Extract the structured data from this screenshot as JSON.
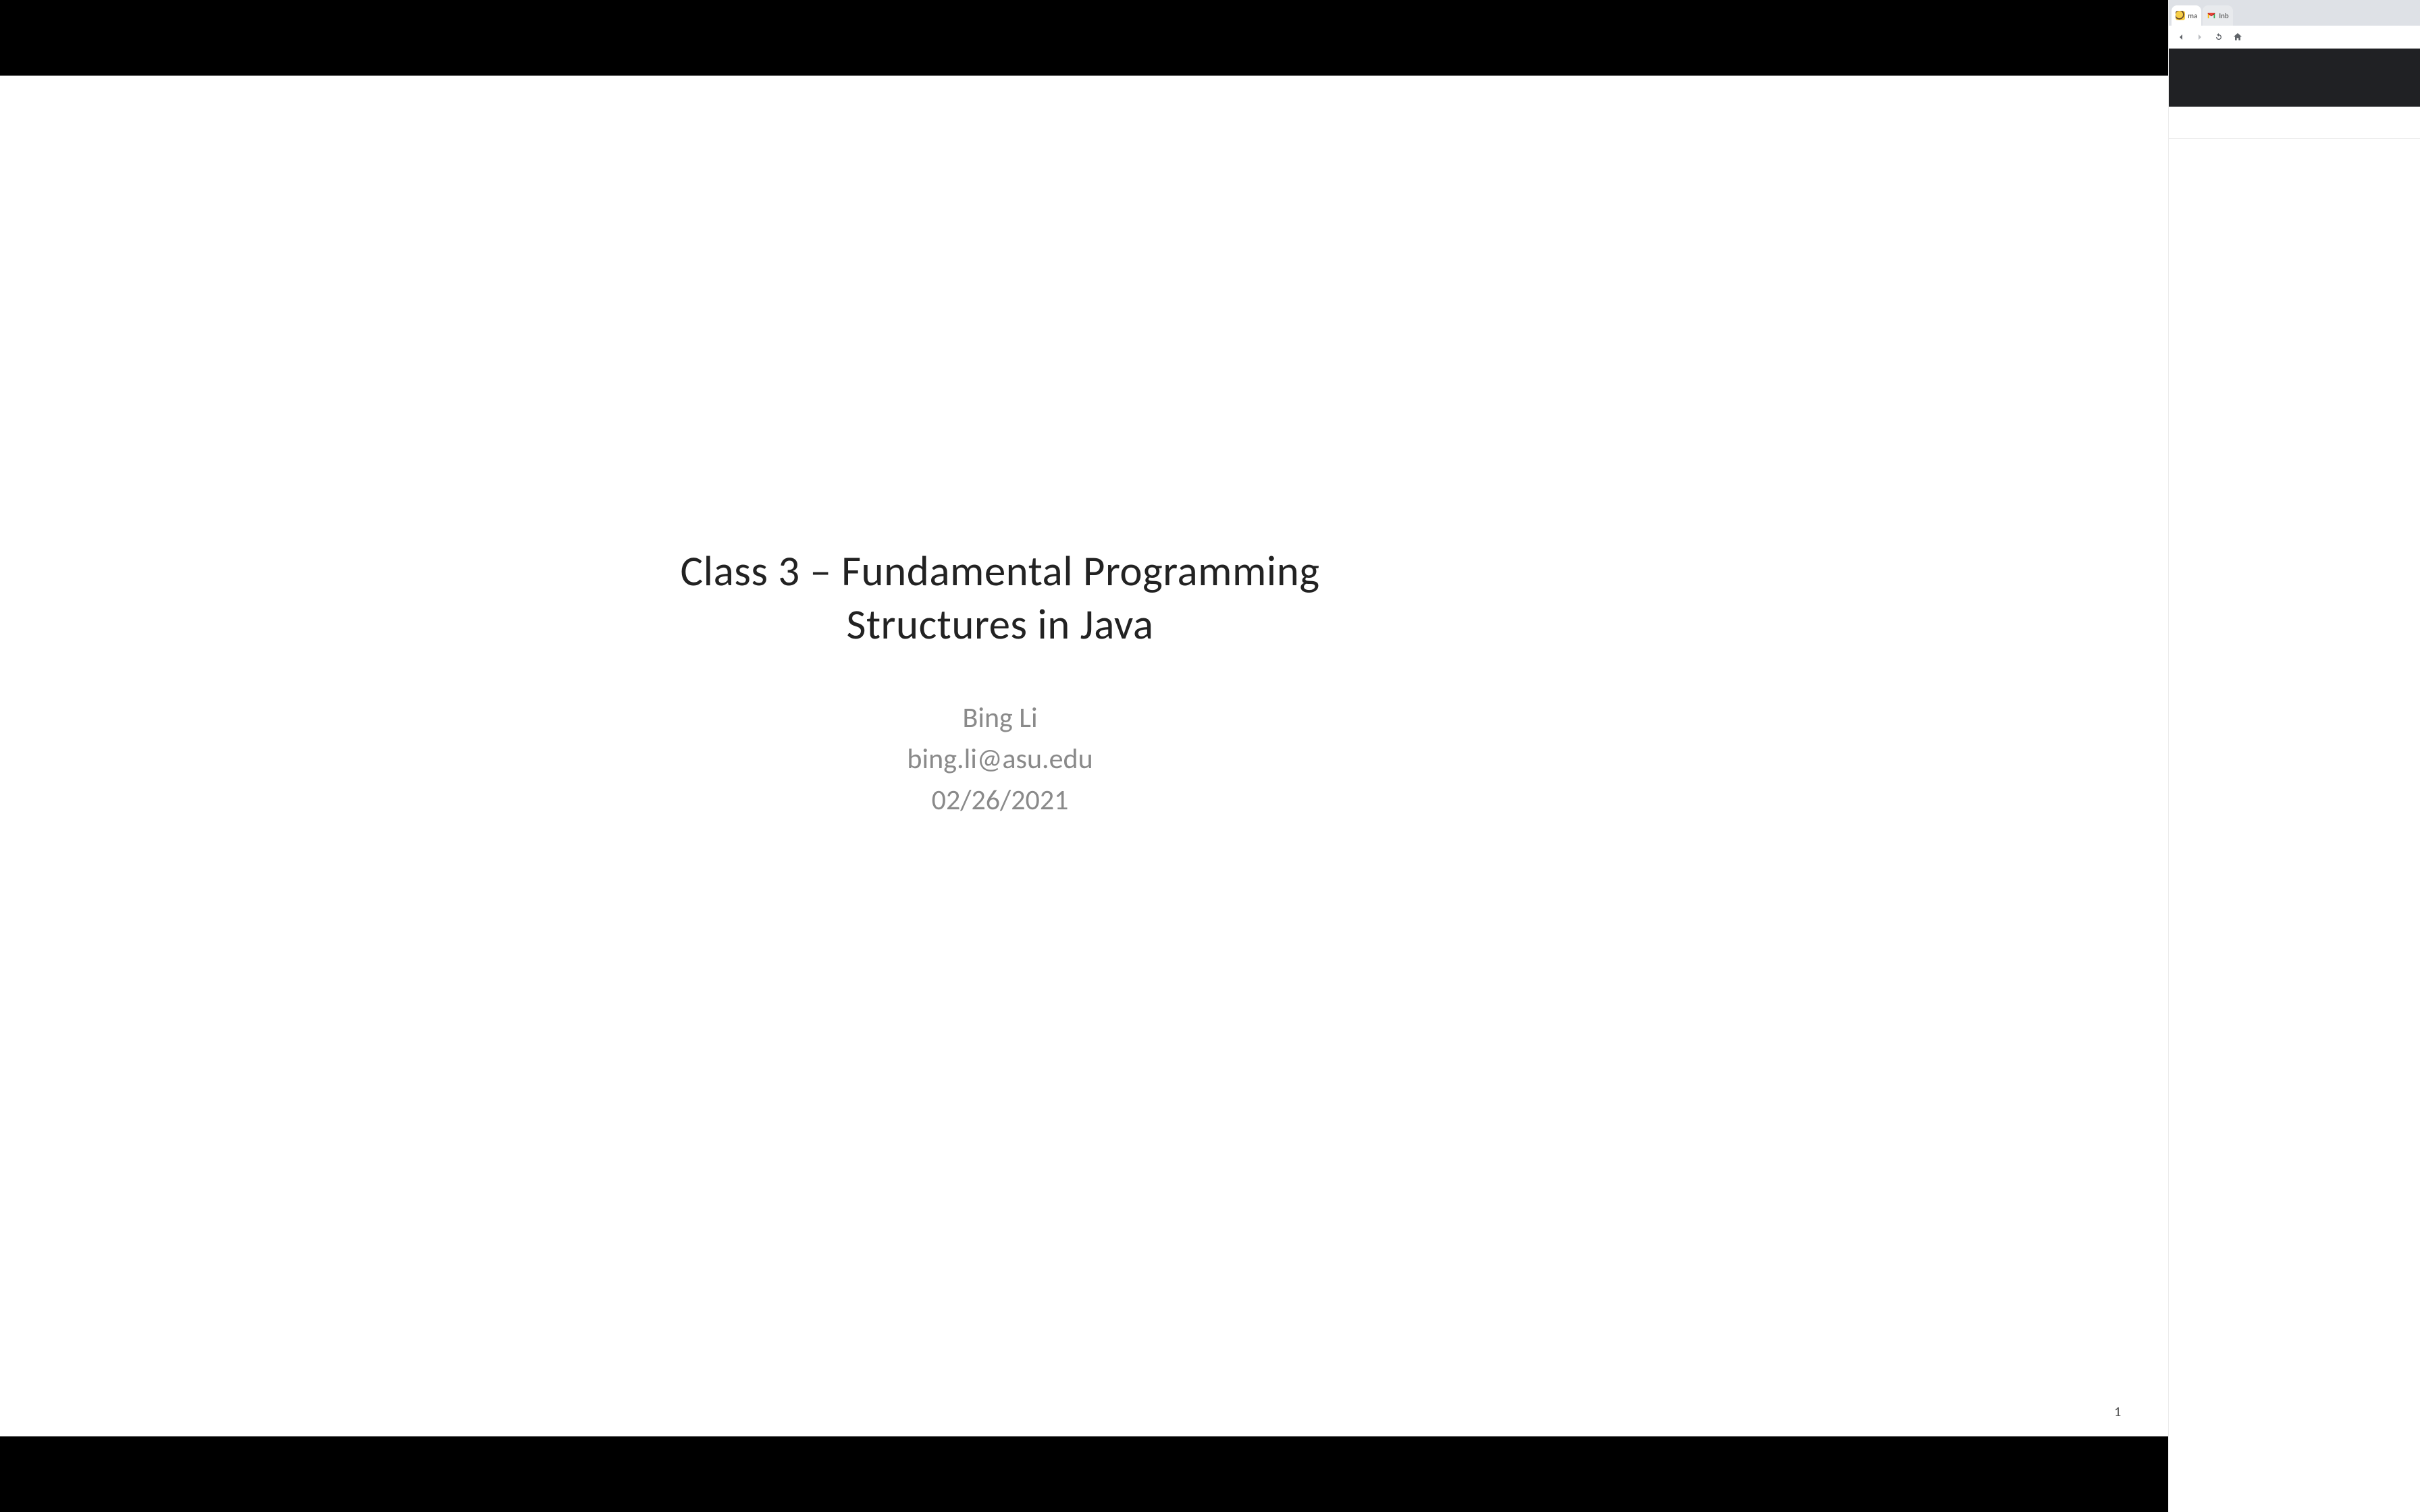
{
  "slide": {
    "title_line1": "Class 3 – Fundamental Programming",
    "title_line2": "Structures in Java",
    "author": "Bing Li",
    "email": "bing.li@asu.edu",
    "date": "02/26/2021",
    "page_number": "1"
  },
  "browser": {
    "tabs": [
      {
        "label": "ma"
      },
      {
        "label": "Inb"
      }
    ]
  }
}
